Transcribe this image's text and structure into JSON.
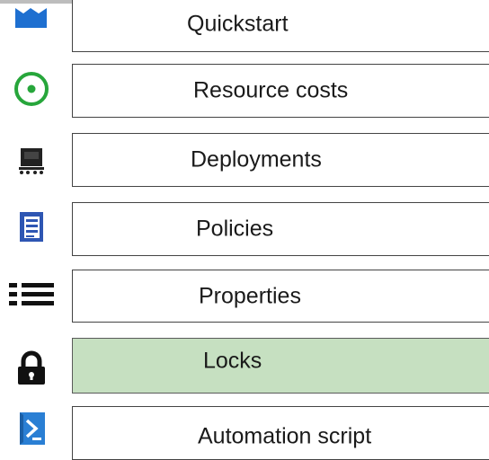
{
  "menu": {
    "items": [
      {
        "label": "Quickstart",
        "icon": "quickstart-icon",
        "selected": false
      },
      {
        "label": "Resource costs",
        "icon": "resource-costs-icon",
        "selected": false
      },
      {
        "label": "Deployments",
        "icon": "deployments-icon",
        "selected": false
      },
      {
        "label": "Policies",
        "icon": "policies-icon",
        "selected": false
      },
      {
        "label": "Properties",
        "icon": "properties-icon",
        "selected": false
      },
      {
        "label": "Locks",
        "icon": "lock-icon",
        "selected": true
      },
      {
        "label": "Automation script",
        "icon": "automation-script-icon",
        "selected": false
      }
    ]
  },
  "colors": {
    "selected_bg": "#c6e0c1",
    "quickstart_blue": "#1e6fd0",
    "cost_green": "#27a63b",
    "policy_blue": "#2e56b3",
    "script_blue": "#2a7fd4"
  }
}
